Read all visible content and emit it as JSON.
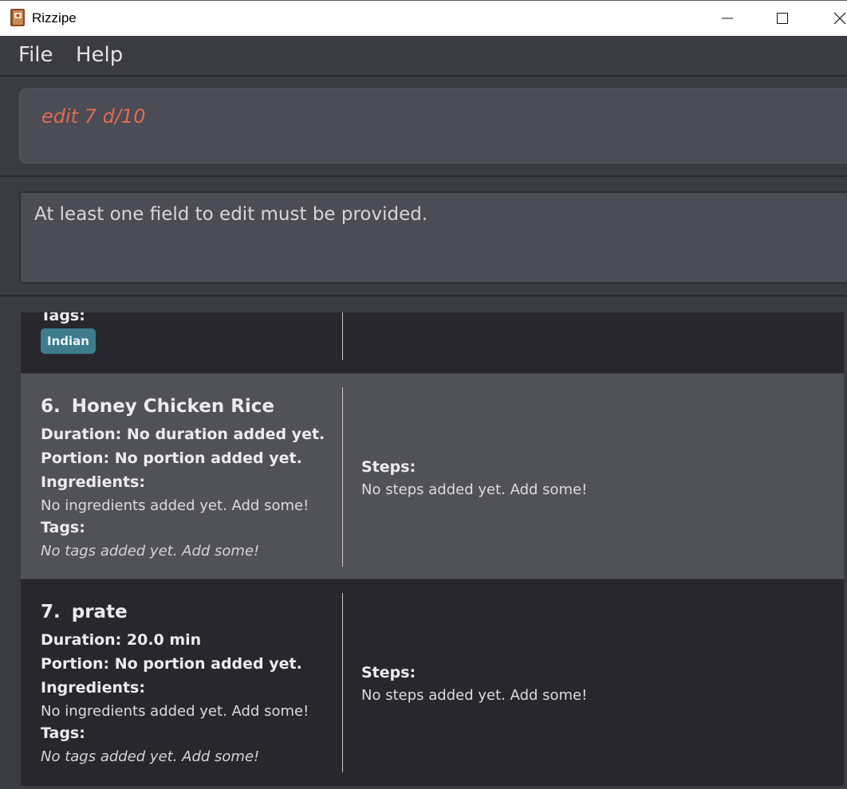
{
  "window": {
    "title": "Rizzipe",
    "controls": [
      "minimize",
      "maximize",
      "close"
    ]
  },
  "menu": {
    "file_label": "File",
    "help_label": "Help"
  },
  "command": {
    "value": "edit 7 d/10",
    "text_color": "#e06a55"
  },
  "result": {
    "message": "At least one field to edit must be provided."
  },
  "recipes": {
    "partial": {
      "tags_label": "Tags:",
      "tags": [
        "Indian"
      ]
    },
    "items": [
      {
        "index": "6.",
        "name": "Honey Chicken Rice",
        "duration": "Duration: No duration added yet.",
        "portion": "Portion: No portion added yet.",
        "ingredients_label": "Ingredients:",
        "ingredients": "No ingredients added yet. Add some!",
        "tags_label": "Tags:",
        "tags": "No tags added yet. Add some!",
        "steps_label": "Steps:",
        "steps": "No steps added yet. Add some!",
        "selected": true
      },
      {
        "index": "7.",
        "name": "prate",
        "duration": "Duration: 20.0 min",
        "portion": "Portion: No portion added yet.",
        "ingredients_label": "Ingredients:",
        "ingredients": "No ingredients added yet. Add some!",
        "tags_label": "Tags:",
        "tags": "No tags added yet. Add some!",
        "steps_label": "Steps:",
        "steps": "No steps added yet. Add some!",
        "selected": false
      }
    ]
  },
  "colors": {
    "background": "#3b3c43",
    "card_dark": "#27272d",
    "card_selected": "#515259",
    "tag_chip": "#3e7c8c",
    "command_text": "#e06a55"
  }
}
